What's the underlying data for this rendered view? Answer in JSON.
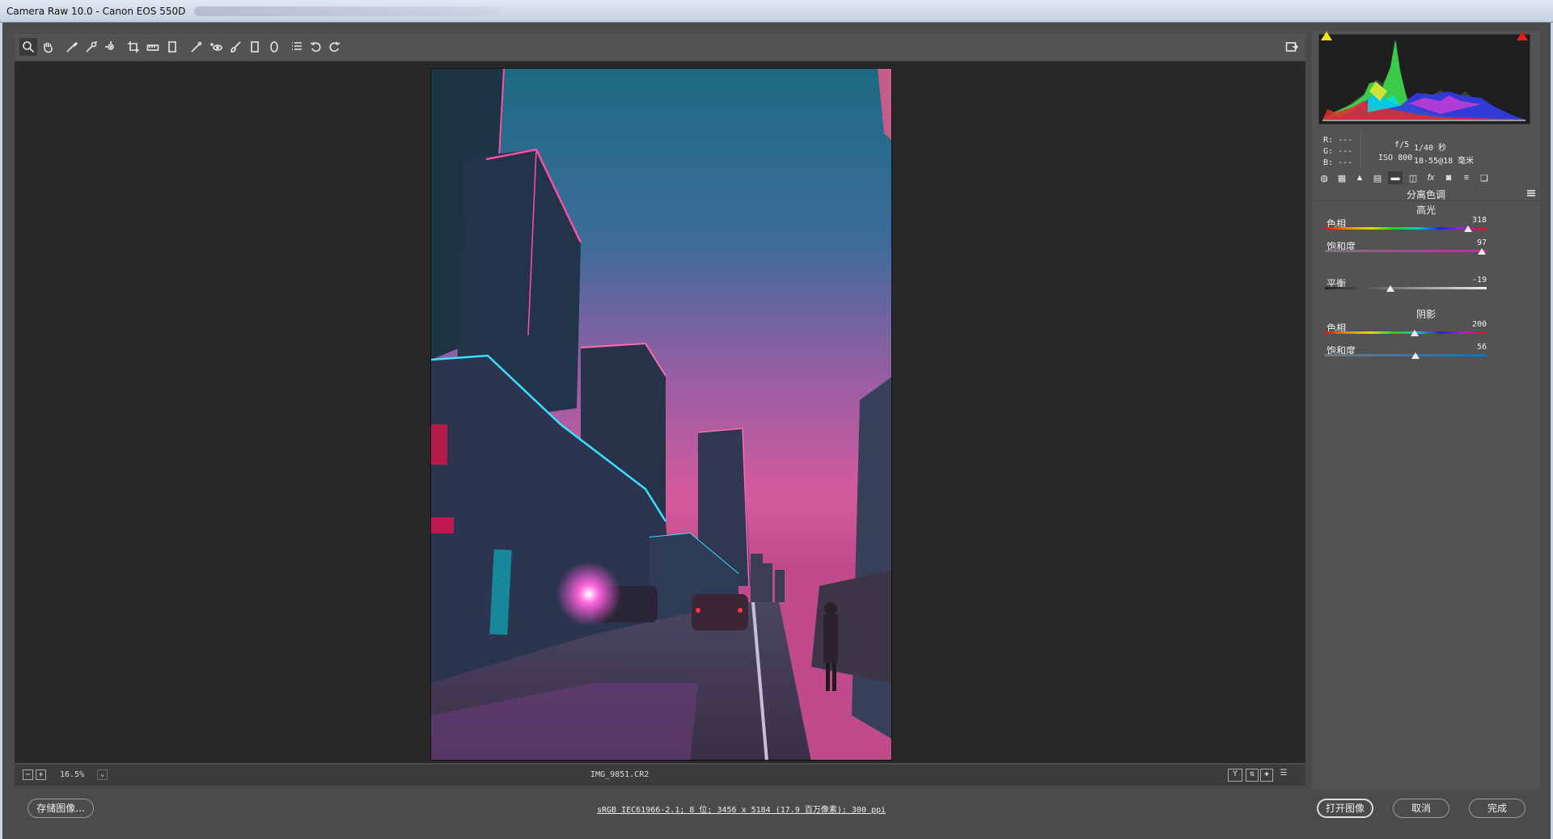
{
  "window": {
    "title": "Camera Raw 10.0 -  Canon EOS 550D"
  },
  "toolbar": {
    "tools": [
      "zoom-tool",
      "hand-tool",
      "white-balance-tool",
      "color-sampler-tool",
      "targeted-adjustment-tool",
      "crop-tool",
      "straighten-tool",
      "transform-tool",
      "spot-removal-tool",
      "red-eye-removal-tool",
      "adjustment-brush-tool",
      "graduated-filter-tool",
      "radial-filter-tool",
      "preferences-tool",
      "rotate-ccw-tool",
      "rotate-cw-tool"
    ],
    "fullscreen_icon": "toggle-fullscreen-icon"
  },
  "status": {
    "zoom": "16.5%",
    "filename": "IMG_9851.CR2",
    "view_icons": [
      "y-compare-icon",
      "swap-icon",
      "copy-settings-icon",
      "settings-icon"
    ]
  },
  "bottom": {
    "save_label": "存储图像...",
    "info_text": "sRGB IEC61966-2.1; 8 位; 3456 x 5184 (17.9 百万像素); 300 ppi",
    "open_label": "打开图像",
    "cancel_label": "取消",
    "done_label": "完成"
  },
  "readout": {
    "r": "R:  ---",
    "g": "G:  ---",
    "b": "B:  ---",
    "aperture": "f/5",
    "shutter": "1/40 秒",
    "iso": "ISO 800",
    "lens": "18-55@18 毫米"
  },
  "panel": {
    "title": "分离色调",
    "highlights_title": "高光",
    "shadows_title": "阴影",
    "highlights": {
      "hue_label": "色相",
      "hue_value": "318",
      "hue_fraction": 0.883,
      "sat_label": "饱和度",
      "sat_value": "97",
      "sat_fraction": 0.97
    },
    "balance": {
      "label": "平衡",
      "value": "-19",
      "fraction": 0.405
    },
    "shadows": {
      "hue_label": "色相",
      "hue_value": "200",
      "hue_fraction": 0.556,
      "sat_label": "饱和度",
      "sat_value": "56",
      "sat_fraction": 0.56
    }
  },
  "colors": {
    "accent_shadow": "#00ffff",
    "accent_highlight": "#ff3c8c"
  }
}
